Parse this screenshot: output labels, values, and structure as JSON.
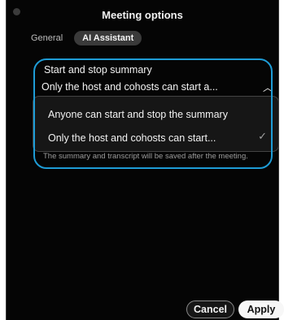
{
  "window": {
    "title": "Meeting options"
  },
  "tabs": [
    {
      "label": "General"
    },
    {
      "label": "AI Assistant"
    }
  ],
  "summary_section": {
    "label": "Start and stop summary",
    "selected_value": "Only the host and cohosts can start a...",
    "options": [
      {
        "label": "Anyone can start and stop the summary"
      },
      {
        "label": "Only the host and cohosts can start..."
      }
    ],
    "note": "The summary and transcript will be saved after the meeting."
  },
  "footer": {
    "cancel_label": "Cancel",
    "apply_label": "Apply"
  },
  "icons": {
    "dropdown": "chevron-up-icon",
    "selected": "check-icon"
  },
  "colors": {
    "highlight": "#1e9cd6",
    "background": "#050505"
  }
}
